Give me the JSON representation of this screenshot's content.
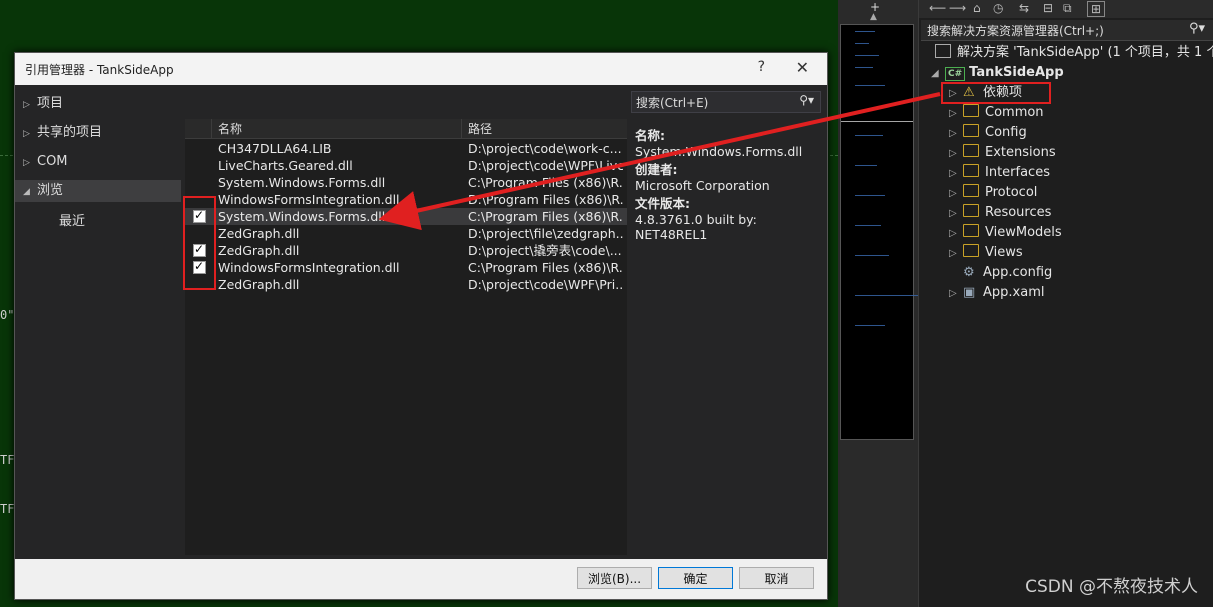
{
  "editor": {
    "frag1": "0\"",
    "frag2": "TF:",
    "frag3": "TF:"
  },
  "solution": {
    "toolbar_icons": [
      "home-icon",
      "history-icon",
      "sync-icon",
      "collapse-icon",
      "copy-icon",
      "switch-view-icon"
    ],
    "search_placeholder": "搜索解决方案资源管理器(Ctrl+;)",
    "solution_label": "解决方案 'TankSideApp' (1 个项目，共 1 个)",
    "project": "TankSideApp",
    "project_badge": "C#",
    "items": [
      {
        "label": "依赖项",
        "icon": "dependencies-warning-icon"
      },
      {
        "label": "Common",
        "icon": "folder-icon"
      },
      {
        "label": "Config",
        "icon": "folder-icon"
      },
      {
        "label": "Extensions",
        "icon": "folder-icon"
      },
      {
        "label": "Interfaces",
        "icon": "folder-icon"
      },
      {
        "label": "Protocol",
        "icon": "folder-icon"
      },
      {
        "label": "Resources",
        "icon": "folder-icon"
      },
      {
        "label": "ViewModels",
        "icon": "folder-icon"
      },
      {
        "label": "Views",
        "icon": "folder-icon"
      },
      {
        "label": "App.config",
        "icon": "config-file-icon"
      },
      {
        "label": "App.xaml",
        "icon": "xaml-file-icon"
      }
    ]
  },
  "dialog": {
    "title": "引用管理器 - TankSideApp",
    "help": "?",
    "close": "✕",
    "nav": [
      {
        "label": "项目",
        "expand": "▷"
      },
      {
        "label": "共享的项目",
        "expand": "▷"
      },
      {
        "label": "COM",
        "expand": "▷"
      },
      {
        "label": "浏览",
        "expand": "◢"
      },
      {
        "label": "最近",
        "expand": ""
      }
    ],
    "search_placeholder": "搜索(Ctrl+E)",
    "columns": {
      "name": "名称",
      "path": "路径"
    },
    "rows": [
      {
        "checked": null,
        "name": "CH347DLLA64.LIB",
        "path": "D:\\project\\code\\work-c..."
      },
      {
        "checked": null,
        "name": "LiveCharts.Geared.dll",
        "path": "D:\\project\\code\\WPF\\Live"
      },
      {
        "checked": null,
        "name": "System.Windows.Forms.dll",
        "path": "C:\\Program Files (x86)\\R..."
      },
      {
        "checked": null,
        "name": "WindowsFormsIntegration.dll",
        "path": "D:\\Program Files (x86)\\R..."
      },
      {
        "checked": true,
        "name": "System.Windows.Forms.dll",
        "path": "C:\\Program Files (x86)\\R..."
      },
      {
        "checked": null,
        "name": "ZedGraph.dll",
        "path": "D:\\project\\file\\zedgraph..."
      },
      {
        "checked": true,
        "name": "ZedGraph.dll",
        "path": "D:\\project\\撬旁表\\code\\..."
      },
      {
        "checked": true,
        "name": "WindowsFormsIntegration.dll",
        "path": "C:\\Program Files (x86)\\R..."
      },
      {
        "checked": null,
        "name": "ZedGraph.dll",
        "path": "D:\\project\\code\\WPF\\Pri..."
      }
    ],
    "detail": {
      "name_label": "名称:",
      "name_value": "System.Windows.Forms.dll",
      "creator_label": "创建者:",
      "creator_value": "Microsoft Corporation",
      "version_label": "文件版本:",
      "version_value": "4.8.3761.0 built by: NET48REL1"
    },
    "buttons": {
      "browse": "浏览(B)...",
      "ok": "确定",
      "cancel": "取消"
    }
  },
  "watermark": "CSDN @不熬夜技术人",
  "colors": {
    "annotation": "#e02020",
    "editor_bg": "#083508",
    "dialog_bg": "#252526"
  }
}
